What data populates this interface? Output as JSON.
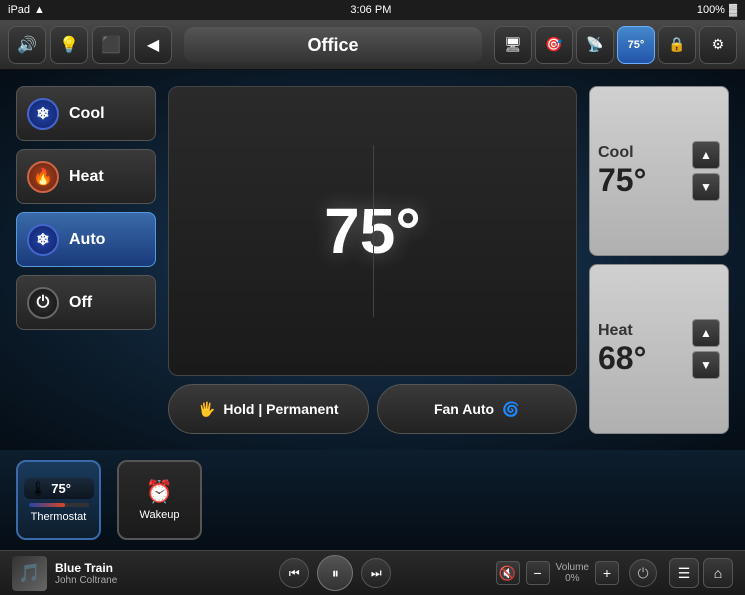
{
  "status_bar": {
    "device": "iPad",
    "wifi_icon": "📶",
    "time": "3:06 PM",
    "battery": "100%",
    "battery_icon": "🔋"
  },
  "nav": {
    "title": "Office",
    "buttons": [
      "🔊",
      "💡",
      "🔴",
      "◀"
    ],
    "right_buttons": [
      "🖥",
      "🎯",
      "📡",
      "75°",
      "🔒",
      "⚙"
    ]
  },
  "thermostat": {
    "current_temp": "75°",
    "modes": [
      {
        "id": "cool",
        "label": "Cool",
        "icon": "❄",
        "active": false
      },
      {
        "id": "heat",
        "label": "Heat",
        "icon": "🔥",
        "active": false
      },
      {
        "id": "auto",
        "label": "Auto",
        "icon": "❄",
        "active": true
      },
      {
        "id": "off",
        "label": "Off",
        "icon": "⏻",
        "active": false
      }
    ],
    "hold_label": "Hold | Permanent",
    "fan_label": "Fan Auto",
    "setpoints": {
      "cool": {
        "label": "Cool",
        "temp": "75°"
      },
      "heat": {
        "label": "Heat",
        "temp": "68°"
      }
    }
  },
  "widgets": [
    {
      "id": "thermostat",
      "label": "Thermostat",
      "temp": "75°",
      "fill_pct": 60
    },
    {
      "id": "wakeup",
      "label": "Wakeup",
      "icon": "⏰"
    }
  ],
  "player": {
    "track_title": "Blue Train",
    "track_artist": "John Coltrane",
    "volume_label": "Volume",
    "volume_value": "0%"
  }
}
